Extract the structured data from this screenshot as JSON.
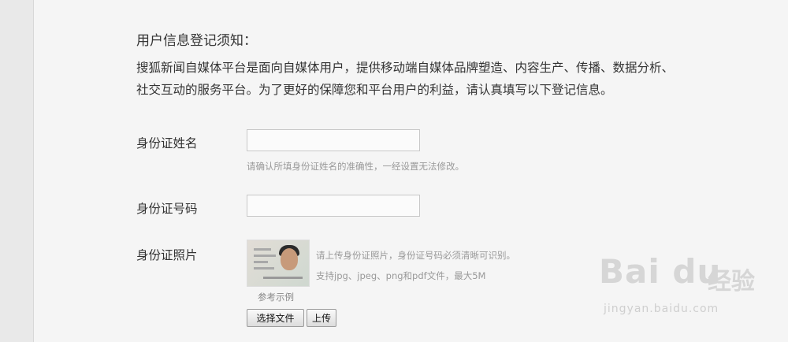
{
  "notice": {
    "title": "用户信息登记须知：",
    "body": "搜狐新闻自媒体平台是面向自媒体用户，提供移动端自媒体品牌塑造、内容生产、传播、数据分析、社交互动的服务平台。为了更好的保障您和平台用户的利益，请认真填写以下登记信息。"
  },
  "form": {
    "id_name": {
      "label": "身份证姓名",
      "value": "",
      "hint": "请确认所填身份证姓名的准确性，一经设置无法修改。"
    },
    "id_number": {
      "label": "身份证号码",
      "value": ""
    },
    "id_photo": {
      "label": "身份证照片",
      "hint_line1": "请上传身份证照片，身份证号码必须清晰可识别。",
      "hint_line2": "支持jpg、jpeg、png和pdf文件，最大5M",
      "sample_caption": "参考示例",
      "choose_file_button": "选择文件",
      "upload_button": "上传"
    }
  },
  "watermark": {
    "brand": "Bai du",
    "brand_cn": "经验",
    "url": "jingyan.baidu.com"
  }
}
